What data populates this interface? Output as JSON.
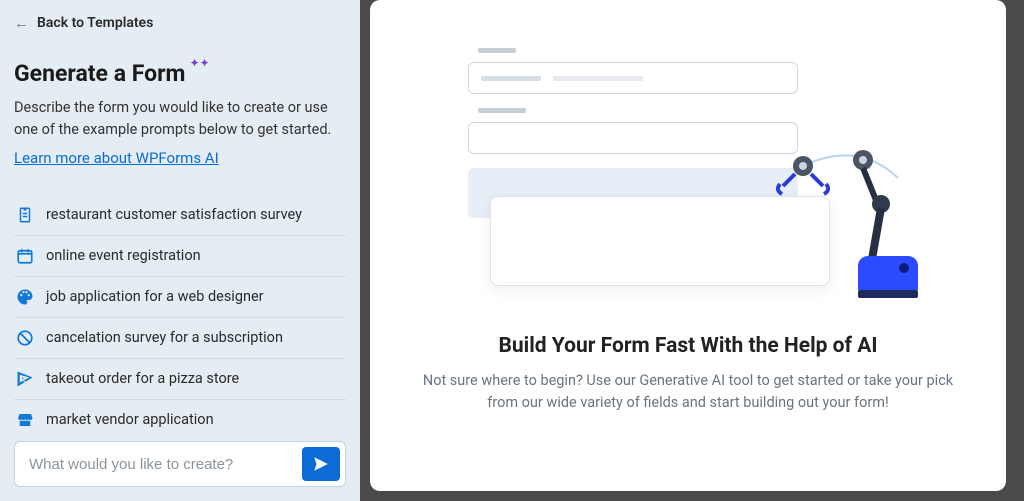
{
  "back": {
    "label": "Back to Templates"
  },
  "title": "Generate a Form",
  "description": "Describe the form you would like to create or use one of the example prompts below to get started.",
  "learn_link": "Learn more about WPForms AI",
  "prompts": [
    {
      "label": "restaurant customer satisfaction survey"
    },
    {
      "label": "online event registration"
    },
    {
      "label": "job application for a web designer"
    },
    {
      "label": "cancelation survey for a subscription"
    },
    {
      "label": "takeout order for a pizza store"
    },
    {
      "label": "market vendor application"
    }
  ],
  "input": {
    "placeholder": "What would you like to create?",
    "value": ""
  },
  "main": {
    "title": "Build Your Form Fast With the Help of AI",
    "description": "Not sure where to begin? Use our Generative AI tool to get started or take your pick from our wide variety of fields and start building out your form!"
  },
  "colors": {
    "accent": "#0b6cd6"
  }
}
